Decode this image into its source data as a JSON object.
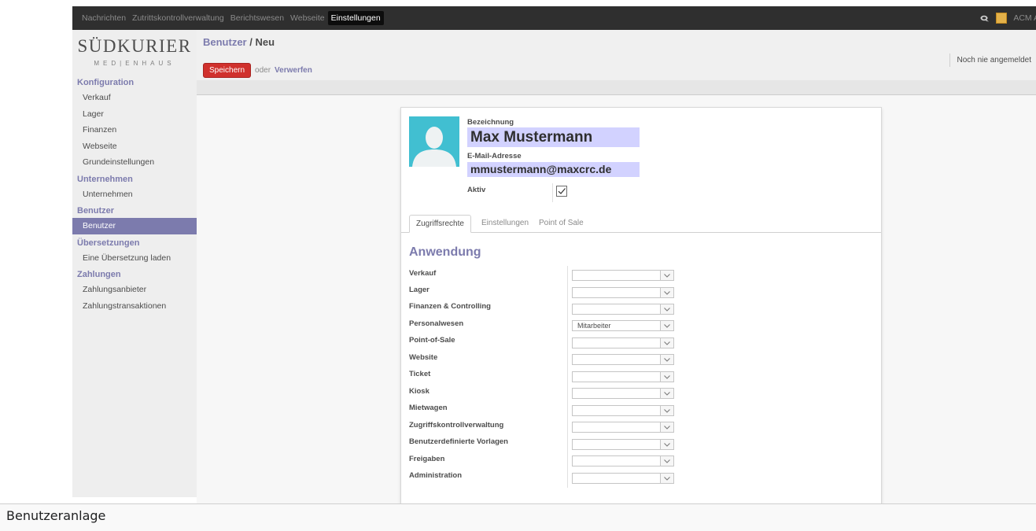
{
  "topbar": {
    "menu": [
      "Nachrichten",
      "Zutrittskontrollverwaltung",
      "Berichtswesen",
      "Webseite",
      "Einstellungen"
    ],
    "active_menu": "Einstellungen",
    "user_label": "ACM A"
  },
  "logo": {
    "line1": "SÜDKURIER",
    "line2": "MED|ENHAUS"
  },
  "sidebar": {
    "sections": [
      {
        "title": "Konfiguration",
        "items": [
          "Verkauf",
          "Lager",
          "Finanzen",
          "Webseite",
          "Grundeinstellungen"
        ]
      },
      {
        "title": "Unternehmen",
        "items": [
          "Unternehmen"
        ]
      },
      {
        "title": "Benutzer",
        "items": [
          "Benutzer"
        ]
      },
      {
        "title": "Übersetzungen",
        "items": [
          "Eine Übersetzung laden"
        ]
      },
      {
        "title": "Zahlungen",
        "items": [
          "Zahlungsanbieter",
          "Zahlungstransaktionen"
        ]
      }
    ],
    "active_item": "Benutzer"
  },
  "header": {
    "breadcrumb_link": "Benutzer",
    "breadcrumb_sep": " / ",
    "breadcrumb_current": "Neu",
    "save_label": "Speichern",
    "or_label": "oder",
    "discard_label": "Verwerfen",
    "status": "Noch nie angemeldet"
  },
  "form": {
    "name_label": "Bezeichnung",
    "name_value": "Max Mustermann",
    "email_label": "E-Mail-Adresse",
    "email_value": "mmustermann@maxcrc.de",
    "active_label": "Aktiv",
    "active_checked": true,
    "tabs": [
      "Zugriffsrechte",
      "Einstellungen",
      "Point of Sale"
    ],
    "active_tab": "Zugriffsrechte",
    "section_title": "Anwendung",
    "rows": [
      {
        "label": "Verkauf",
        "value": ""
      },
      {
        "label": "Lager",
        "value": ""
      },
      {
        "label": "Finanzen & Controlling",
        "value": ""
      },
      {
        "label": "Personalwesen",
        "value": "Mitarbeiter"
      },
      {
        "label": "Point-of-Sale",
        "value": ""
      },
      {
        "label": "Website",
        "value": ""
      },
      {
        "label": "Ticket",
        "value": ""
      },
      {
        "label": "Kiosk",
        "value": ""
      },
      {
        "label": "Mietwagen",
        "value": ""
      },
      {
        "label": "Zugriffskontrollverwaltung",
        "value": ""
      },
      {
        "label": "Benutzerdefinierte Vorlagen",
        "value": ""
      },
      {
        "label": "Freigaben",
        "value": ""
      },
      {
        "label": "Administration",
        "value": ""
      }
    ]
  },
  "caption": "Benutzeranlage",
  "colors": {
    "accent": "#7c7bad",
    "save": "#d0312d",
    "topbar": "#2f2f2f",
    "avatar": "#41bfd1",
    "field_bg": "#d2d2ff"
  }
}
